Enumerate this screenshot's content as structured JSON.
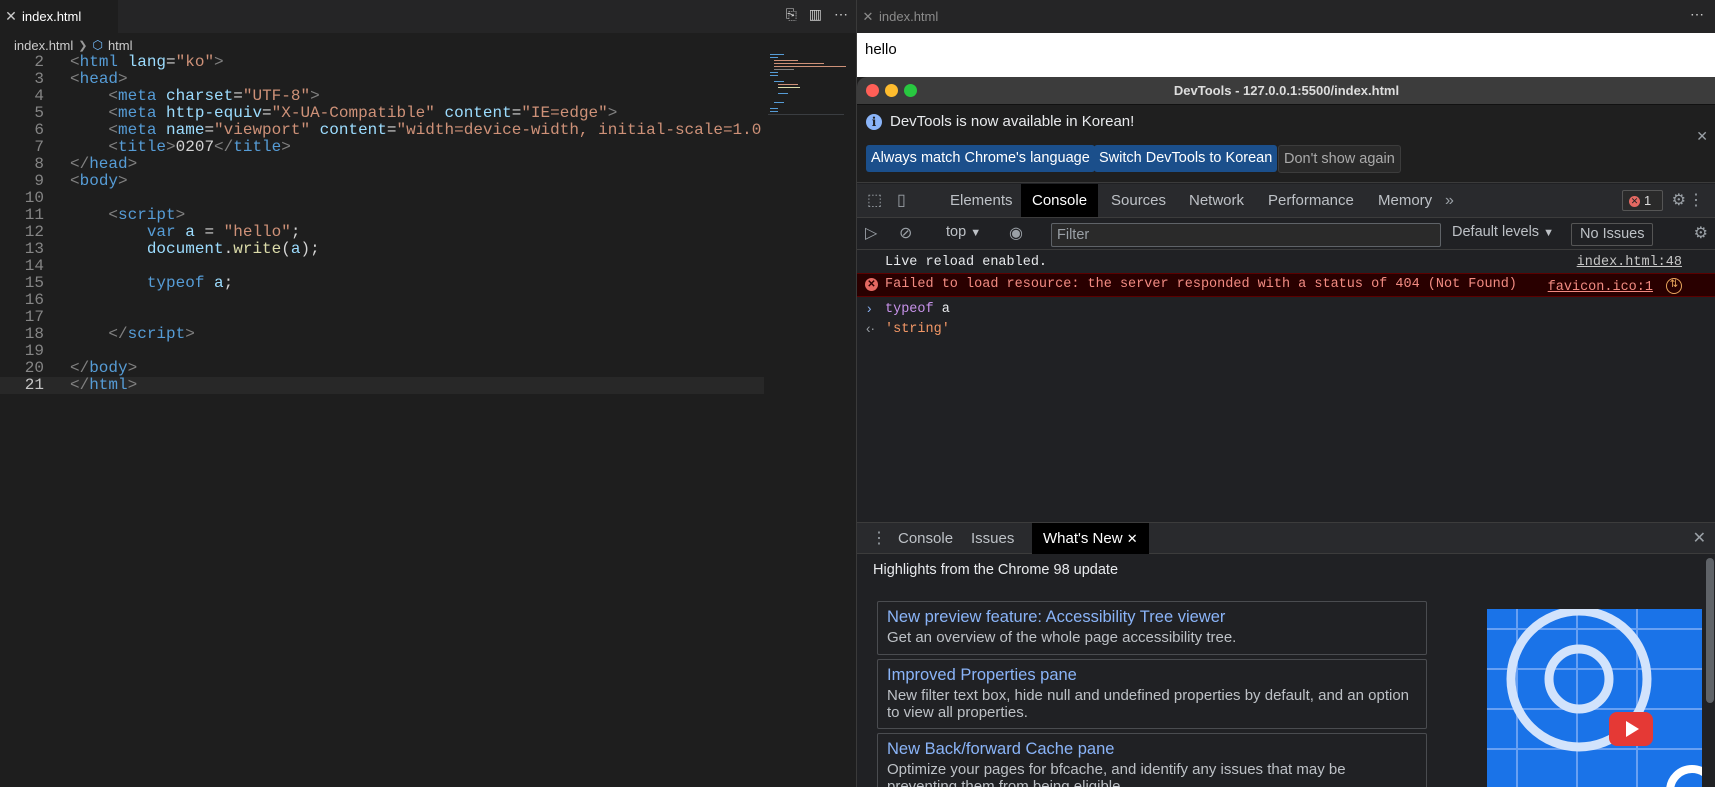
{
  "editor": {
    "tab_label": "index.html",
    "breadcrumb": {
      "file": "index.html",
      "symbol": "html"
    },
    "active_line": "21",
    "lines": [
      {
        "n": "2",
        "tokens": [
          [
            "br",
            "<"
          ],
          [
            "tag",
            "html"
          ],
          [
            "txt",
            " "
          ],
          [
            "attr",
            "lang"
          ],
          [
            "txt",
            "="
          ],
          [
            "str",
            "\"ko\""
          ],
          [
            "br",
            ">"
          ]
        ]
      },
      {
        "n": "3",
        "tokens": [
          [
            "br",
            "<"
          ],
          [
            "tag",
            "head"
          ],
          [
            "br",
            ">"
          ]
        ]
      },
      {
        "n": "4",
        "tokens": [
          [
            "txt",
            "    "
          ],
          [
            "br",
            "<"
          ],
          [
            "tag",
            "meta"
          ],
          [
            "txt",
            " "
          ],
          [
            "attr",
            "charset"
          ],
          [
            "txt",
            "="
          ],
          [
            "str",
            "\"UTF-8\""
          ],
          [
            "br",
            ">"
          ]
        ]
      },
      {
        "n": "5",
        "tokens": [
          [
            "txt",
            "    "
          ],
          [
            "br",
            "<"
          ],
          [
            "tag",
            "meta"
          ],
          [
            "txt",
            " "
          ],
          [
            "attr",
            "http-equiv"
          ],
          [
            "txt",
            "="
          ],
          [
            "str",
            "\"X-UA-Compatible\""
          ],
          [
            "txt",
            " "
          ],
          [
            "attr",
            "content"
          ],
          [
            "txt",
            "="
          ],
          [
            "str",
            "\"IE=edge\""
          ],
          [
            "br",
            ">"
          ]
        ]
      },
      {
        "n": "6",
        "tokens": [
          [
            "txt",
            "    "
          ],
          [
            "br",
            "<"
          ],
          [
            "tag",
            "meta"
          ],
          [
            "txt",
            " "
          ],
          [
            "attr",
            "name"
          ],
          [
            "txt",
            "="
          ],
          [
            "str",
            "\"viewport\""
          ],
          [
            "txt",
            " "
          ],
          [
            "attr",
            "content"
          ],
          [
            "txt",
            "="
          ],
          [
            "str",
            "\"width=device-width, initial-scale=1.0"
          ]
        ]
      },
      {
        "n": "7",
        "tokens": [
          [
            "txt",
            "    "
          ],
          [
            "br",
            "<"
          ],
          [
            "tag",
            "title"
          ],
          [
            "br",
            ">"
          ],
          [
            "txt",
            "0207"
          ],
          [
            "br",
            "</"
          ],
          [
            "tag",
            "title"
          ],
          [
            "br",
            ">"
          ]
        ]
      },
      {
        "n": "8",
        "tokens": [
          [
            "br",
            "</"
          ],
          [
            "tag",
            "head"
          ],
          [
            "br",
            ">"
          ]
        ]
      },
      {
        "n": "9",
        "tokens": [
          [
            "br",
            "<"
          ],
          [
            "tag",
            "body"
          ],
          [
            "br",
            ">"
          ]
        ]
      },
      {
        "n": "10",
        "tokens": []
      },
      {
        "n": "11",
        "tokens": [
          [
            "txt",
            "    "
          ],
          [
            "br",
            "<"
          ],
          [
            "tag",
            "script"
          ],
          [
            "br",
            ">"
          ]
        ]
      },
      {
        "n": "12",
        "tokens": [
          [
            "txt",
            "        "
          ],
          [
            "kw",
            "var"
          ],
          [
            "txt",
            " "
          ],
          [
            "var",
            "a"
          ],
          [
            "txt",
            " = "
          ],
          [
            "str",
            "\"hello\""
          ],
          [
            "txt",
            ";"
          ]
        ]
      },
      {
        "n": "13",
        "tokens": [
          [
            "txt",
            "        "
          ],
          [
            "var",
            "document"
          ],
          [
            "txt",
            "."
          ],
          [
            "fn",
            "write"
          ],
          [
            "txt",
            "("
          ],
          [
            "var",
            "a"
          ],
          [
            "txt",
            ");"
          ]
        ]
      },
      {
        "n": "14",
        "tokens": []
      },
      {
        "n": "15",
        "tokens": [
          [
            "txt",
            "        "
          ],
          [
            "kw",
            "typeof"
          ],
          [
            "txt",
            " "
          ],
          [
            "var",
            "a"
          ],
          [
            "txt",
            ";"
          ]
        ]
      },
      {
        "n": "16",
        "tokens": []
      },
      {
        "n": "17",
        "tokens": []
      },
      {
        "n": "18",
        "tokens": [
          [
            "txt",
            "    "
          ],
          [
            "br",
            "</"
          ],
          [
            "tag",
            "script"
          ],
          [
            "br",
            ">"
          ]
        ]
      },
      {
        "n": "19",
        "tokens": []
      },
      {
        "n": "20",
        "tokens": [
          [
            "br",
            "</"
          ],
          [
            "tag",
            "body"
          ],
          [
            "br",
            ">"
          ]
        ]
      },
      {
        "n": "21",
        "tokens": [
          [
            "br",
            "</"
          ],
          [
            "tag",
            "html"
          ],
          [
            "br",
            ">"
          ]
        ]
      }
    ]
  },
  "browser": {
    "tab_label": "index.html",
    "page_text": "hello"
  },
  "devtools": {
    "title": "DevTools - 127.0.0.1:5500/index.html",
    "infobar": {
      "message": "DevTools is now available in Korean!",
      "btn_match": "Always match Chrome's language",
      "btn_switch": "Switch DevTools to Korean",
      "btn_dismiss": "Don't show again"
    },
    "tabs": [
      "Elements",
      "Console",
      "Sources",
      "Network",
      "Performance",
      "Memory"
    ],
    "error_count": "1",
    "toolbar": {
      "context": "top",
      "filter_placeholder": "Filter",
      "levels": "Default levels",
      "issues": "No Issues"
    },
    "console": {
      "live_reload": "Live reload enabled.",
      "live_reload_src": "index.html:48",
      "error_text": "Failed to load resource: the server responded with a status of 404 (Not Found)",
      "error_src": "favicon.ico:1",
      "input_kw": "typeof",
      "input_rest": " a",
      "result": "'string'"
    },
    "drawer": {
      "tabs": [
        "Console",
        "Issues",
        "What's New"
      ],
      "heading": "Highlights from the Chrome 98 update",
      "cards": [
        {
          "title": "New preview feature: Accessibility Tree viewer",
          "desc": "Get an overview of the whole page accessibility tree."
        },
        {
          "title": "Improved Properties pane",
          "desc": "New filter text box, hide null and undefined properties by default, and an option to view all properties."
        },
        {
          "title": "New Back/forward Cache pane",
          "desc": "Optimize your pages for bfcache, and identify any issues that may be preventing them from being eligible."
        }
      ]
    }
  },
  "colors": {
    "editor_bg": "#1e1e1e",
    "devtools_bg": "#202124",
    "error_bg": "#290000",
    "link": "#8ab4f8",
    "primary_button": "#1b4f8b"
  }
}
